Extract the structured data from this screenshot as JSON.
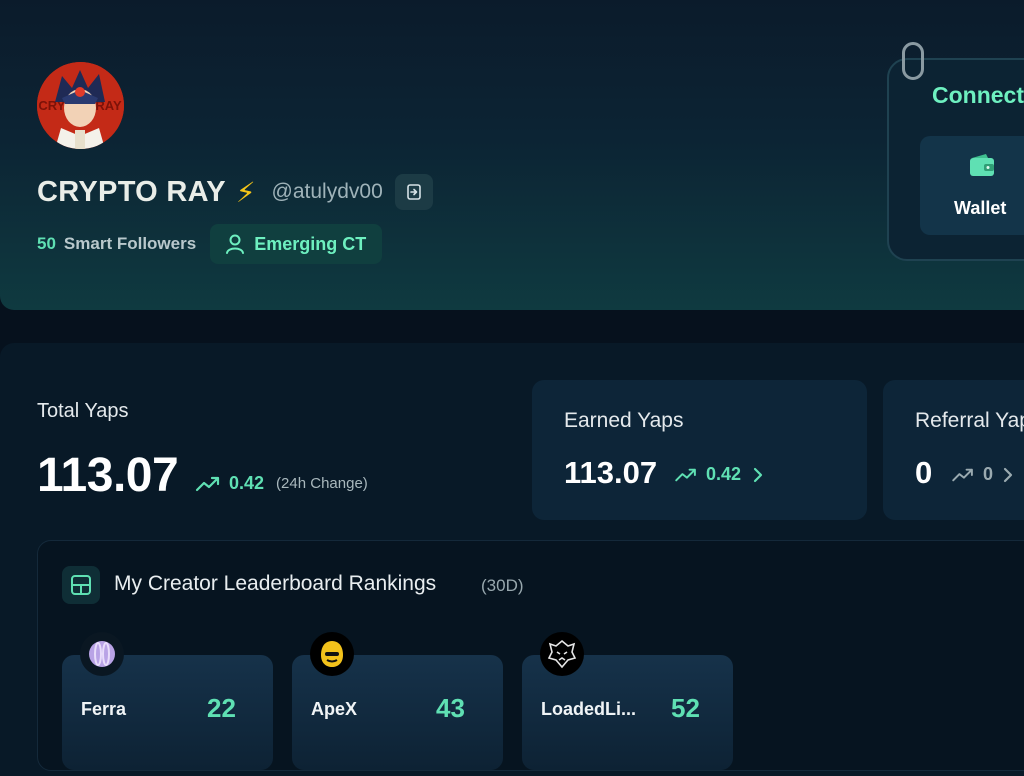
{
  "profile": {
    "display_name": "CRYPTO RAY",
    "emoji": "⚡",
    "handle": "@atulydv00",
    "followers_count": "50",
    "followers_label": "Smart Followers",
    "badge_label": "Emerging CT",
    "avatar_text": "CRYPTO RAY"
  },
  "connect": {
    "title": "Connect",
    "wallet_label": "Wallet"
  },
  "total_yaps": {
    "label": "Total Yaps",
    "value": "113.07",
    "change": "0.42",
    "change_note": "(24h Change)"
  },
  "earned_yaps": {
    "label": "Earned Yaps",
    "value": "113.07",
    "change": "0.42"
  },
  "referral_yaps": {
    "label": "Referral Yaps",
    "value": "0",
    "change": "0"
  },
  "leaderboard": {
    "title": "My Creator Leaderboard Rankings",
    "period": "(30D)",
    "items": [
      {
        "name": "Ferra",
        "rank": "22",
        "icon": "ferra-logo-icon"
      },
      {
        "name": "ApeX",
        "rank": "43",
        "icon": "apex-logo-icon"
      },
      {
        "name": "LoadedLi...",
        "rank": "52",
        "icon": "loadedlions-logo-icon"
      }
    ]
  },
  "colors": {
    "accent": "#5fe0b3",
    "background": "#06111d",
    "card": "#0d2538"
  }
}
